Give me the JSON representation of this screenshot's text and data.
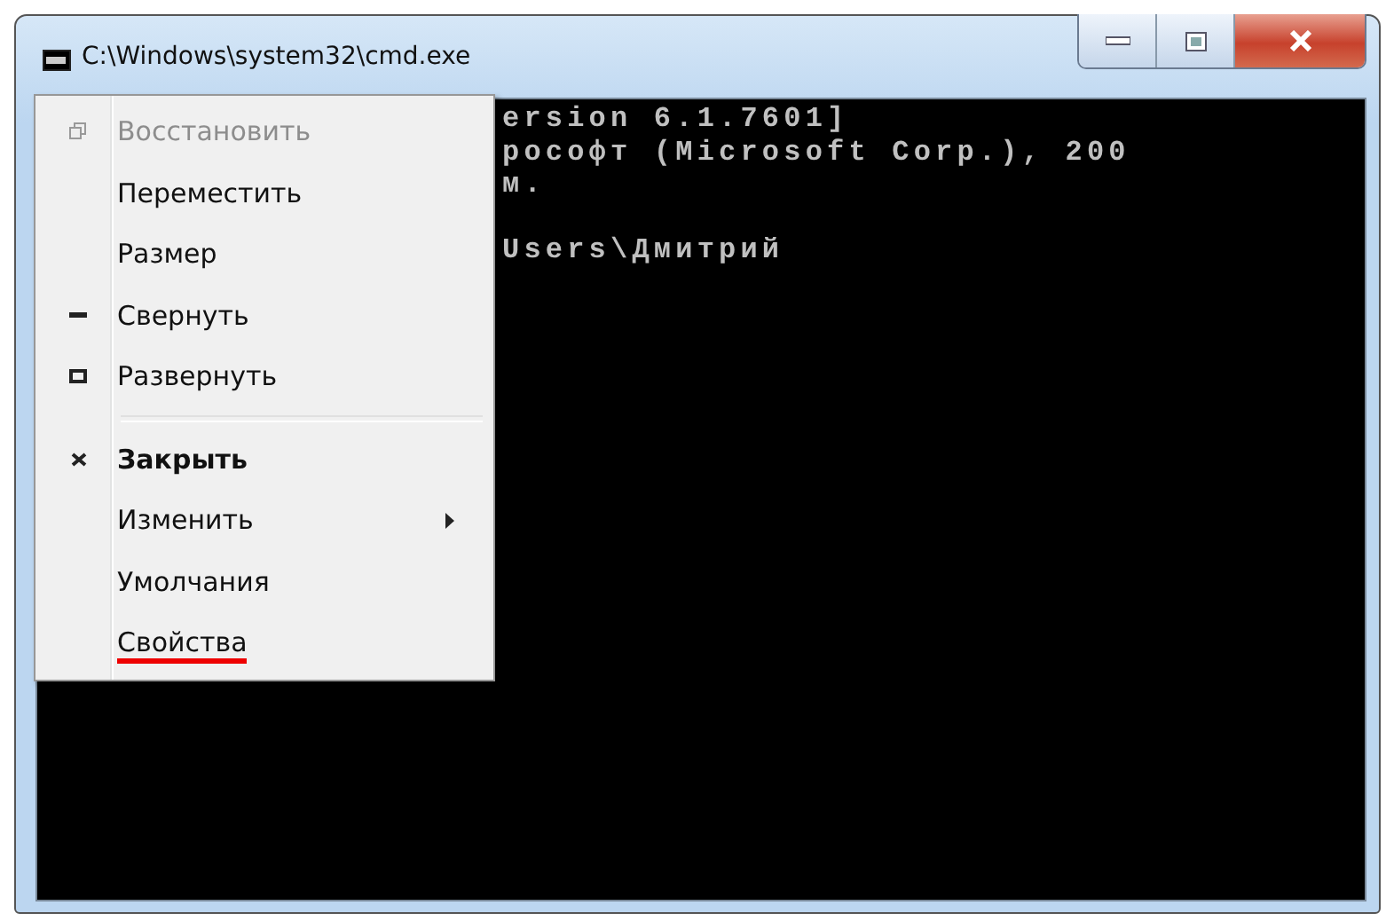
{
  "window": {
    "title": "C:\\Windows\\system32\\cmd.exe"
  },
  "console": {
    "banner": [
      "ersion 6.1.7601]",
      "рософт (Microsoft Corp.), 200",
      "м."
    ],
    "prompt": "Users\\Дмитрий"
  },
  "menu": {
    "groups": [
      [
        {
          "label": "Восстановить",
          "kind": "restore",
          "disabled": true,
          "default": false,
          "submenu": false,
          "underlined": false
        },
        {
          "label": "Переместить",
          "kind": "plain",
          "disabled": false,
          "default": false,
          "submenu": false,
          "underlined": false
        },
        {
          "label": "Размер",
          "kind": "plain",
          "disabled": false,
          "default": false,
          "submenu": false,
          "underlined": false
        },
        {
          "label": "Свернуть",
          "kind": "minimize",
          "disabled": false,
          "default": false,
          "submenu": false,
          "underlined": false
        },
        {
          "label": "Развернуть",
          "kind": "maximize",
          "disabled": false,
          "default": false,
          "submenu": false,
          "underlined": false
        }
      ],
      [
        {
          "label": "Закрыть",
          "kind": "close",
          "disabled": false,
          "default": true,
          "submenu": false,
          "underlined": false
        },
        {
          "label": "Изменить",
          "kind": "plain",
          "disabled": false,
          "default": false,
          "submenu": true,
          "underlined": false
        },
        {
          "label": "Умолчания",
          "kind": "plain",
          "disabled": false,
          "default": false,
          "submenu": false,
          "underlined": false
        },
        {
          "label": "Свойства",
          "kind": "plain",
          "disabled": false,
          "default": false,
          "submenu": false,
          "underlined": true
        }
      ]
    ]
  }
}
